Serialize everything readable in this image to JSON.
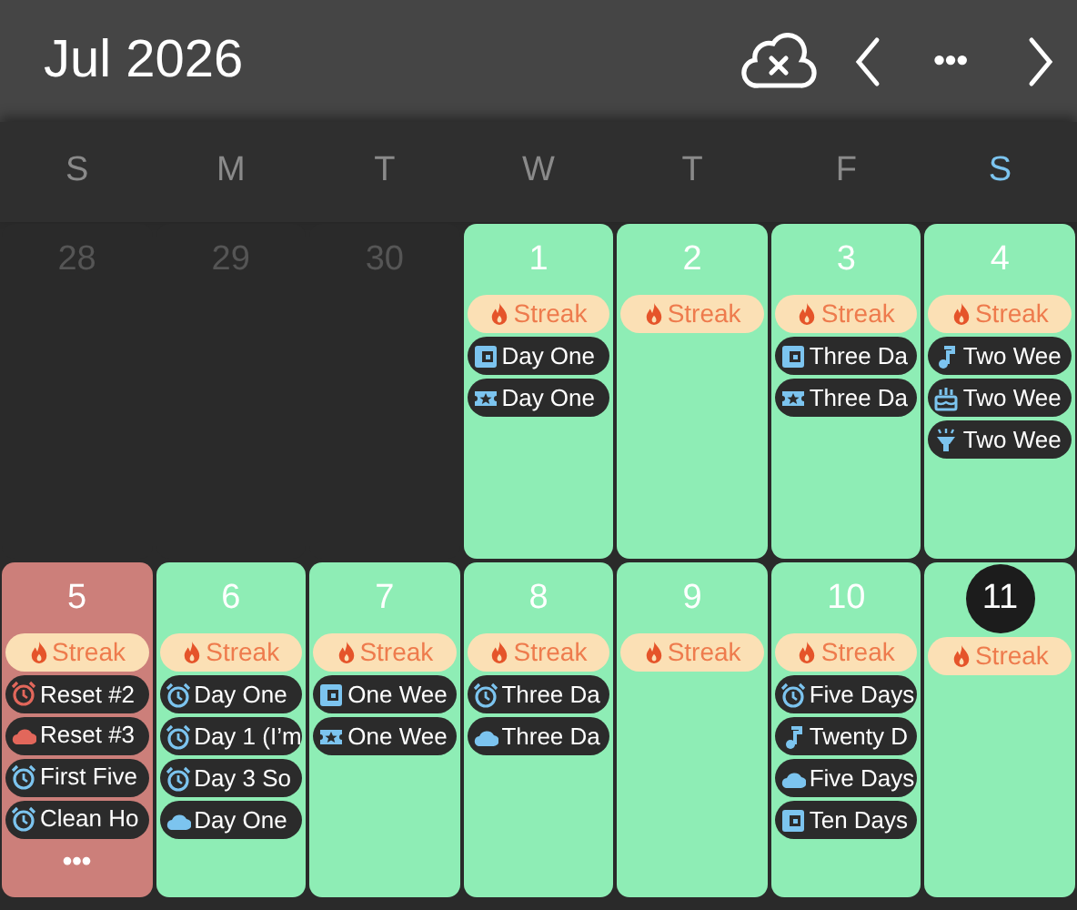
{
  "header": {
    "title": "Jul 2026",
    "more": "•••"
  },
  "weekdays": [
    {
      "label": "S",
      "highlighted": false
    },
    {
      "label": "M",
      "highlighted": false
    },
    {
      "label": "T",
      "highlighted": false
    },
    {
      "label": "W",
      "highlighted": false
    },
    {
      "label": "T",
      "highlighted": false
    },
    {
      "label": "F",
      "highlighted": false
    },
    {
      "label": "S",
      "highlighted": true
    }
  ],
  "weeks": [
    [
      {
        "number": "28",
        "kind": "outside",
        "today": false
      },
      {
        "number": "29",
        "kind": "outside",
        "today": false
      },
      {
        "number": "30",
        "kind": "outside",
        "today": false
      },
      {
        "number": "1",
        "kind": "done",
        "today": false,
        "streak": "Streak",
        "events": [
          {
            "kind": "book",
            "color": "#7cc4ef",
            "label": "Day One"
          },
          {
            "kind": "ticket",
            "color": "#7cc4ef",
            "label": "Day One"
          }
        ]
      },
      {
        "number": "2",
        "kind": "done",
        "today": false,
        "streak": "Streak"
      },
      {
        "number": "3",
        "kind": "done",
        "today": false,
        "streak": "Streak",
        "events": [
          {
            "kind": "book",
            "color": "#7cc4ef",
            "label": "Three Da"
          },
          {
            "kind": "ticket",
            "color": "#7cc4ef",
            "label": "Three Da"
          }
        ]
      },
      {
        "number": "4",
        "kind": "done",
        "today": false,
        "streak": "Streak",
        "events": [
          {
            "kind": "note",
            "color": "#7cc4ef",
            "label": "Two Wee"
          },
          {
            "kind": "cake",
            "color": "#7cc4ef",
            "label": "Two Wee"
          },
          {
            "kind": "lamp",
            "color": "#7cc4ef",
            "label": "Two Wee"
          }
        ]
      }
    ],
    [
      {
        "number": "5",
        "kind": "missed",
        "today": false,
        "streak": "Streak",
        "events": [
          {
            "kind": "alarm",
            "color": "#e2675b",
            "label": "Reset #2"
          },
          {
            "kind": "cloud",
            "color": "#e2675b",
            "label": "Reset #3"
          },
          {
            "kind": "alarm",
            "color": "#7cc4ef",
            "label": "First Five"
          },
          {
            "kind": "alarm",
            "color": "#7cc4ef",
            "label": "Clean Ho"
          }
        ],
        "more": "•••"
      },
      {
        "number": "6",
        "kind": "done",
        "today": false,
        "streak": "Streak",
        "events": [
          {
            "kind": "alarm",
            "color": "#7cc4ef",
            "label": "Day One"
          },
          {
            "kind": "alarm",
            "color": "#7cc4ef",
            "label": "Day 1 (I’m"
          },
          {
            "kind": "alarm",
            "color": "#7cc4ef",
            "label": "Day 3 So"
          },
          {
            "kind": "cloud",
            "color": "#7cc4ef",
            "label": "Day One"
          }
        ]
      },
      {
        "number": "7",
        "kind": "done",
        "today": false,
        "streak": "Streak",
        "events": [
          {
            "kind": "book",
            "color": "#7cc4ef",
            "label": "One Wee"
          },
          {
            "kind": "ticket",
            "color": "#7cc4ef",
            "label": "One Wee"
          }
        ]
      },
      {
        "number": "8",
        "kind": "done",
        "today": false,
        "streak": "Streak",
        "events": [
          {
            "kind": "alarm",
            "color": "#7cc4ef",
            "label": "Three Da"
          },
          {
            "kind": "cloud",
            "color": "#7cc4ef",
            "label": "Three Da"
          }
        ]
      },
      {
        "number": "9",
        "kind": "done",
        "today": false,
        "streak": "Streak"
      },
      {
        "number": "10",
        "kind": "done",
        "today": false,
        "streak": "Streak",
        "events": [
          {
            "kind": "alarm",
            "color": "#7cc4ef",
            "label": "Five Days"
          },
          {
            "kind": "note",
            "color": "#7cc4ef",
            "label": "Twenty D"
          },
          {
            "kind": "cloud",
            "color": "#7cc4ef",
            "label": "Five Days"
          },
          {
            "kind": "book",
            "color": "#7cc4ef",
            "label": "Ten Days"
          }
        ]
      },
      {
        "number": "11",
        "kind": "done",
        "today": true,
        "streak": "Streak"
      }
    ]
  ]
}
